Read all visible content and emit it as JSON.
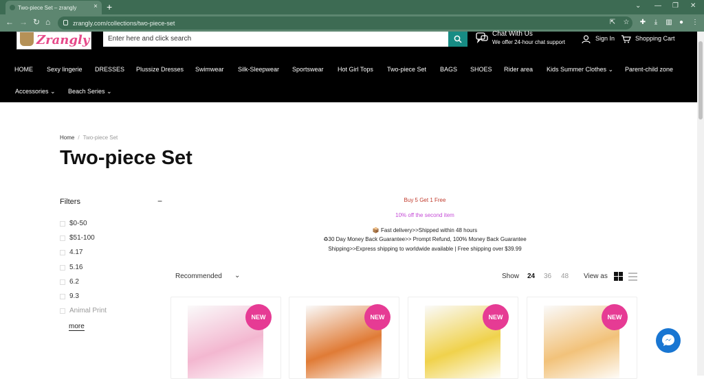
{
  "browser": {
    "tab_title": "Two-piece Set – zrangly",
    "tab_close": "×",
    "new_tab": "+",
    "url": "zrangly.com/collections/two-piece-set"
  },
  "header": {
    "logo_text": "Zrangly",
    "search_placeholder": "Enter here and click search",
    "chat_title": "Chat With Us",
    "chat_sub": "We offer 24-hour chat support",
    "sign_in": "Sign In",
    "cart": "Shopping Cart"
  },
  "menu": {
    "row1": [
      "HOME",
      "Sexy lingerie",
      "DRESSES",
      "Plussize Dresses",
      "Swimwear",
      "Silk-Sleepwear",
      "Sportswear",
      "Hot Girl Tops",
      "Two-piece Set",
      "BAGS",
      "SHOES",
      "Rider area",
      "Kids Summer Clothes ⌄",
      "Parent-child zone"
    ],
    "row2": [
      "Accessories ⌄",
      "Beach Series ⌄"
    ]
  },
  "breadcrumb": {
    "home": "Home",
    "sep": "/",
    "current": "Two-piece Set"
  },
  "page_title": "Two-piece Set",
  "filters": {
    "title": "Filters",
    "collapse": "−",
    "items": [
      "$0-50",
      "$51-100",
      "4.17",
      "5.16",
      "6.2",
      "9.3",
      "Animal Print"
    ],
    "more": "more"
  },
  "promo": {
    "line1": "Buy 5 Get 1 Free",
    "line2": "10% off the second item",
    "line3": "📦 Fast delivery>>Shipped within 48 hours",
    "line4": "♻30 Day Money Back Guarantee>> Prompt Refund, 100% Money Back Guarantee",
    "line5": "Shipping>>Express shipping to worldwide available | Free shipping over $39.99",
    "color1": "#c0392b",
    "color2": "#c44ad6"
  },
  "toolbar": {
    "sort": "Recommended",
    "show_label": "Show",
    "show_options": [
      "24",
      "36",
      "48"
    ],
    "view_as": "View as"
  },
  "products": {
    "badge": "NEW",
    "colors": [
      "#f3b7d0",
      "#e07b36",
      "#f0d24c",
      "#f2c27a"
    ]
  }
}
